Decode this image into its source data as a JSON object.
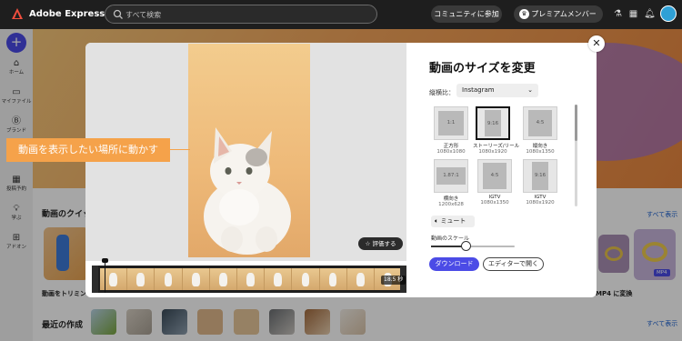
{
  "topbar": {
    "app_title": "Adobe Express",
    "search_placeholder": "すべて検索",
    "community_label": "コミュニティに参加",
    "premium_label": "プレミアムメンバー"
  },
  "rail": {
    "items": [
      {
        "label": "ホーム"
      },
      {
        "label": "マイファイル"
      },
      {
        "label": "ブランド"
      },
      {
        "label": "テンプレ"
      },
      {
        "label": "投稿予約"
      },
      {
        "label": "学ぶ"
      },
      {
        "label": "アドオン"
      }
    ]
  },
  "background": {
    "quick_actions_title": "動画のクイッ",
    "see_all_1": "すべて表示",
    "trim_label": "動画をトリミング",
    "mp4_label": "MP4 に変換",
    "mp4_badge": "MP4",
    "recent_title": "最近の作成",
    "see_all_2": "すべて表示",
    "fragment_label": "に"
  },
  "modal": {
    "title": "動画のサイズを変更",
    "ratio_label": "縦横比：",
    "ratio_value": "Instagram",
    "presets": [
      {
        "ratio": "1:1",
        "name": "正方形",
        "size": "1080x1080",
        "selected": false
      },
      {
        "ratio": "9:16",
        "name": "ストーリーズ/リール",
        "size": "1080x1920",
        "selected": true
      },
      {
        "ratio": "4:5",
        "name": "縦向き",
        "size": "1080x1350",
        "selected": false
      },
      {
        "ratio": "1.87:1",
        "name": "横向き",
        "size": "1200x628",
        "selected": false
      },
      {
        "ratio": "4:5",
        "name": "IGTV",
        "size": "1080x1350",
        "selected": false
      },
      {
        "ratio": "9:16",
        "name": "IGTV",
        "size": "1080x1920",
        "selected": false
      }
    ],
    "mute_label": "ミュート",
    "scale_label": "動画のスケール",
    "scale_value": 0.42,
    "download_label": "ダウンロード",
    "editor_label": "エディターで開く",
    "rate_label": "評価する",
    "duration": "18.5 秒"
  },
  "callout": {
    "text": "動画を表示したい場所に動かす"
  }
}
